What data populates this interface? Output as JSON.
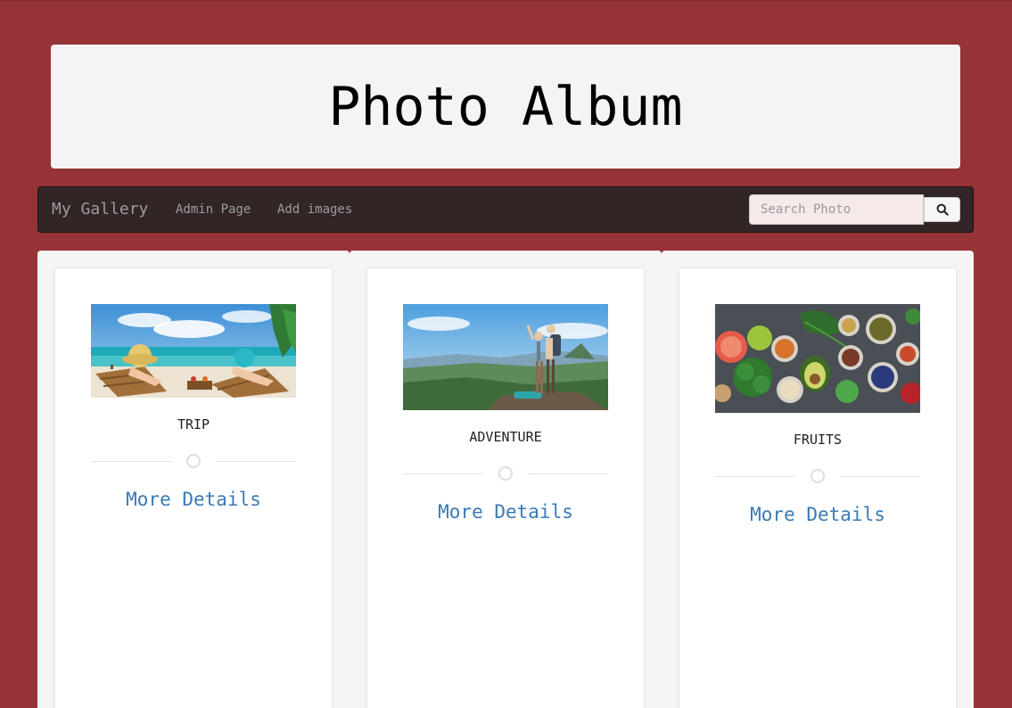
{
  "header": {
    "title": "Photo Album"
  },
  "navbar": {
    "brand": "My Gallery",
    "links": [
      {
        "label": "Admin Page"
      },
      {
        "label": "Add images"
      }
    ],
    "search": {
      "placeholder": "Search Photo",
      "value": "",
      "button_icon": "search-icon"
    }
  },
  "gallery": {
    "cards": [
      {
        "caption": "TRIP",
        "link_label": "More Details",
        "image": "beach-loungers-photo"
      },
      {
        "caption": "ADVENTURE",
        "link_label": "More Details",
        "image": "hikers-mountain-photo"
      },
      {
        "caption": "FRUITS",
        "link_label": "More Details",
        "image": "fruits-vegetables-photo"
      }
    ]
  },
  "colors": {
    "page_background": "#963336",
    "navbar_background": "#312525",
    "link_color": "#3a7ab5"
  }
}
